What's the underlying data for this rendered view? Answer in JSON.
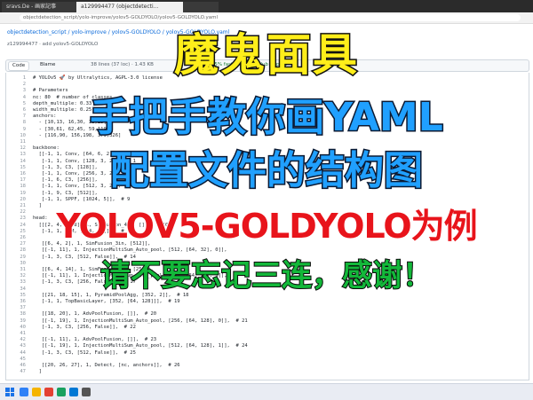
{
  "browser": {
    "tabs": [
      {
        "label": "sravs.De - 画家記事"
      },
      {
        "label": "a129994477 (objectdetecti..."
      },
      {
        "label": ""
      }
    ],
    "address": "objectdetection_script/yolo-improve/yolov5-GOLDYOLO/yolov5-GOLDYOLO.yaml"
  },
  "file": {
    "breadcrumb": "objectdetection_script / yolo-improve / yolov5-GOLDYOLO / yolov5-GOLDYOLO.yaml",
    "commit": "z129994477  ·  add yolov5-GOLDYOLO",
    "code_tab": "Code",
    "blame_tab": "Blame",
    "meta": "38 lines (37 loc) · 1.43 KB",
    "copilot": "Code 55% faster with GitHub Copilot"
  },
  "code": [
    {
      "n": "1",
      "t": "# YOLOv5 🚀 by Ultralytics, AGPL-3.0 license"
    },
    {
      "n": "2",
      "t": ""
    },
    {
      "n": "3",
      "t": "# Parameters"
    },
    {
      "n": "4",
      "t": "nc: 80  # number of classes"
    },
    {
      "n": "5",
      "t": "depth_multiple: 0.33"
    },
    {
      "n": "6",
      "t": "width_multiple: 0.25"
    },
    {
      "n": "7",
      "t": "anchors:"
    },
    {
      "n": "8",
      "t": "  - [10,13, 16,30, 33,23]"
    },
    {
      "n": "9",
      "t": "  - [30,61, 62,45, 59,119]"
    },
    {
      "n": "10",
      "t": "  - [116,90, 156,198, 373,326]"
    },
    {
      "n": "11",
      "t": ""
    },
    {
      "n": "12",
      "t": "backbone:"
    },
    {
      "n": "13",
      "t": "  [[-1, 1, Conv, [64, 6, 2, 2]],  # 0"
    },
    {
      "n": "14",
      "t": "   [-1, 1, Conv, [128, 3, 2]],  # 1"
    },
    {
      "n": "15",
      "t": "   [-1, 3, C3, [128]],"
    },
    {
      "n": "16",
      "t": "   [-1, 1, Conv, [256, 3, 2]],"
    },
    {
      "n": "17",
      "t": "   [-1, 6, C3, [256]],"
    },
    {
      "n": "18",
      "t": "   [-1, 1, Conv, [512, 3, 2]],"
    },
    {
      "n": "19",
      "t": "   [-1, 9, C3, [512]],"
    },
    {
      "n": "20",
      "t": "   [-1, 1, SPPF, [1024, 5]],  # 9"
    },
    {
      "n": "21",
      "t": "  ]"
    },
    {
      "n": "22",
      "t": ""
    },
    {
      "n": "23",
      "t": "head:"
    },
    {
      "n": "24",
      "t": "  [[[2, 4, 6, 8], 1, SimFusion_4in, []],  # 10"
    },
    {
      "n": "25",
      "t": "   [-1, 1, IFM, [[64, 32]]],  # 11"
    },
    {
      "n": "26",
      "t": ""
    },
    {
      "n": "27",
      "t": "   [[6, 4, 2], 1, SimFusion_3in, [512]],"
    },
    {
      "n": "28",
      "t": "   [[-1, 11], 1, InjectionMultiSum_Auto_pool, [512, [64, 32], 0]],"
    },
    {
      "n": "29",
      "t": "   [-1, 3, C3, [512, False]],  # 14"
    },
    {
      "n": "30",
      "t": ""
    },
    {
      "n": "31",
      "t": "   [[6, 4, 14], 1, SimFusion_3in, [256]],"
    },
    {
      "n": "32",
      "t": "   [[-1, 11], 1, InjectionMultiSum_Auto_pool, [256, [64, 32], 1]],"
    },
    {
      "n": "33",
      "t": "   [-1, 3, C3, [256, False]],  # 17"
    },
    {
      "n": "34",
      "t": ""
    },
    {
      "n": "35",
      "t": "   [[21, 18, 15], 1, PyramidPoolAgg, [352, 2]],  # 18"
    },
    {
      "n": "36",
      "t": "   [-1, 1, TopBasicLayer, [352, [64, 128]]],  # 19"
    },
    {
      "n": "37",
      "t": ""
    },
    {
      "n": "38",
      "t": "   [[18, 20], 1, AdvPoolFusion, []],  # 20"
    },
    {
      "n": "39",
      "t": "   [[-1, 19], 1, InjectionMultiSum_Auto_pool, [256, [64, 128], 0]],  # 21"
    },
    {
      "n": "40",
      "t": "   [-1, 3, C3, [256, False]],  # 22"
    },
    {
      "n": "41",
      "t": ""
    },
    {
      "n": "42",
      "t": "   [[-1, 11], 1, AdvPoolFusion, []],  # 23"
    },
    {
      "n": "43",
      "t": "   [[-1, 19], 1, InjectionMultiSum_Auto_pool, [512, [64, 128], 1]],  # 24"
    },
    {
      "n": "44",
      "t": "   [-1, 3, C3, [512, False]],  # 25"
    },
    {
      "n": "45",
      "t": ""
    },
    {
      "n": "46",
      "t": "   [[20, 26, 27], 1, Detect, [nc, anchors]],  # 26"
    },
    {
      "n": "47",
      "t": "  ]"
    }
  ],
  "overlay": {
    "title": "魔鬼面具",
    "line1": "手把手教你画YAML",
    "line2": "配置文件的结构图",
    "line3": "YOLOV5-GOLDYOLO为例",
    "line4": "请不要忘记三连，感谢！"
  },
  "taskbar": {
    "time": "",
    "date": ""
  },
  "colors": {
    "title": "#ffee1a",
    "blue_text": "#20a0ff",
    "red_text": "#e8141b",
    "green_text": "#13b83a"
  }
}
